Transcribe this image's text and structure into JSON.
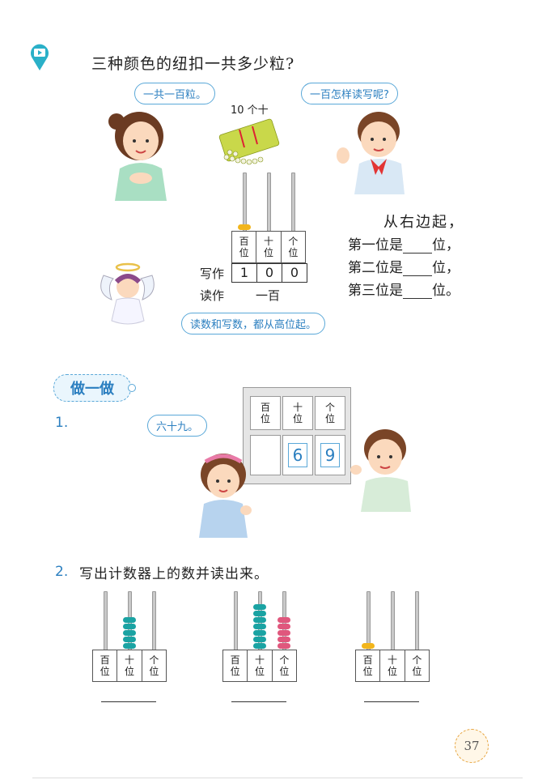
{
  "header": {
    "icon": "video-icon",
    "question": "三种颜色的纽扣一共多少粒?"
  },
  "bubbles": {
    "girl": "一共一百粒。",
    "boy": "一百怎样读写呢?",
    "angel": "读数和写数，都从高位起。",
    "girl2": "六十九。"
  },
  "bundle_label": "10 个十",
  "place_labels": {
    "hundreds": "百\n位",
    "tens": "十\n位",
    "ones": "个\n位"
  },
  "write_row": {
    "label": "写作",
    "digits": [
      "1",
      "0",
      "0"
    ]
  },
  "read_row": {
    "label": "读作",
    "value": "一百"
  },
  "right_text": {
    "line1": "从右边起，",
    "line2a": "第一位是",
    "line2b": "位，",
    "line3a": "第二位是",
    "line3b": "位，",
    "line4a": "第三位是",
    "line4b": "位。"
  },
  "section": {
    "title": "做一做"
  },
  "exercise1": {
    "number": "1.",
    "tens_digit": "6",
    "ones_digit": "9"
  },
  "exercise2": {
    "number": "2.",
    "text": "写出计数器上的数并读出来。"
  },
  "abacus": [
    {
      "hundreds": 0,
      "tens": 5,
      "ones": 0
    },
    {
      "hundreds": 0,
      "tens": 7,
      "ones": 5
    },
    {
      "hundreds": 1,
      "tens": 0,
      "ones": 0
    }
  ],
  "colors": {
    "accent_blue": "#2b7fc0",
    "bead_teal": "#1aa3a3",
    "bead_pink": "#e0577d",
    "bead_yellow": "#f2b51c"
  },
  "page_number": "37"
}
